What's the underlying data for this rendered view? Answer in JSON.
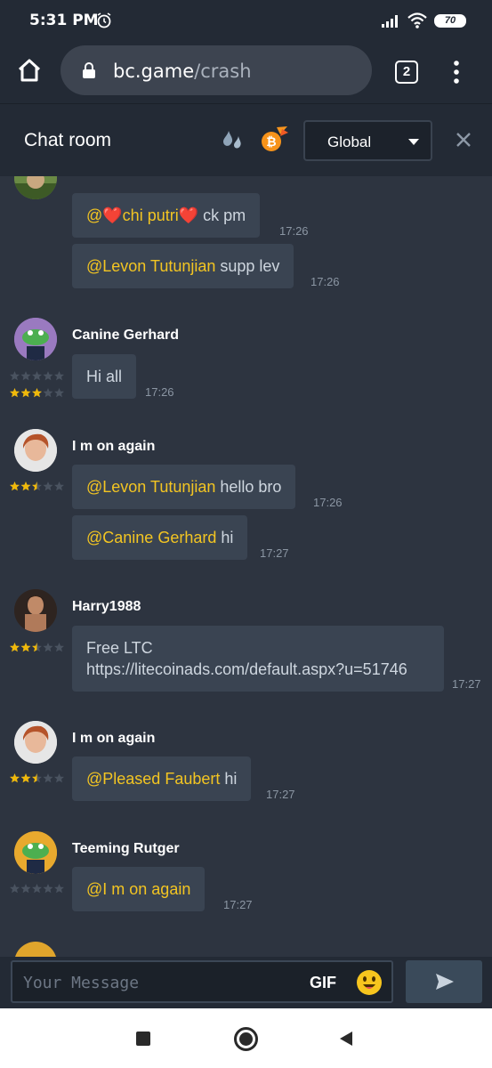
{
  "status_bar": {
    "time": "5:31 PM",
    "battery": "70"
  },
  "browser": {
    "url_host": "bc.game",
    "url_path": "/crash",
    "tab_count": "2"
  },
  "chat_header": {
    "title": "Chat room",
    "channel": "Global"
  },
  "messages": [
    {
      "username": "",
      "stars": 3,
      "bubbles": [
        {
          "mention": "@❤️chi putri❤️",
          "text": " ck pm",
          "time": "17:26"
        },
        {
          "mention": "@Levon Tutunjian",
          "text": " supp lev",
          "time": "17:26"
        }
      ]
    },
    {
      "username": "Canine Gerhard",
      "stars": 0,
      "bubbles": [
        {
          "mention": "",
          "text": "Hi all",
          "time": "17:26"
        }
      ]
    },
    {
      "username": "I m on again",
      "stars": 2.5,
      "bubbles": [
        {
          "mention": "@Levon Tutunjian",
          "text": " hello bro",
          "time": "17:26"
        },
        {
          "mention": "@Canine Gerhard",
          "text": " hi",
          "time": "17:27"
        }
      ]
    },
    {
      "username": "Harry1988",
      "stars": 2.5,
      "bubbles": [
        {
          "mention": "",
          "text": "Free LTC",
          "text2": "https://litecoinads.com/default.aspx?u=51746",
          "time": "17:27"
        }
      ]
    },
    {
      "username": "I m on again",
      "stars": 2.5,
      "bubbles": [
        {
          "mention": "@Pleased Faubert",
          "text": " hi",
          "time": "17:27"
        }
      ]
    },
    {
      "username": "Teeming Rutger",
      "stars": 0,
      "bubbles": [
        {
          "mention": "@I m on again",
          "text": "",
          "time": "17:27"
        }
      ]
    }
  ],
  "input": {
    "placeholder": "Your Message",
    "gif_label": "GIF"
  },
  "colors": {
    "mention": "#f3c522",
    "star": "#f0b90b",
    "background": "#2d3440"
  }
}
